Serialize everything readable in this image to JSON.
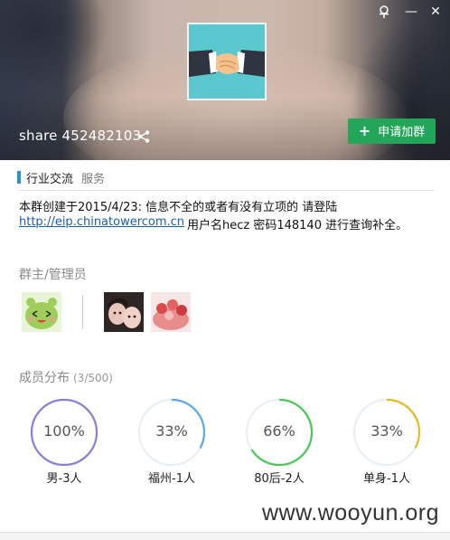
{
  "window": {
    "pin_icon": "pin-icon",
    "min_glyph": "—",
    "close_glyph": "✕"
  },
  "group": {
    "id_label": "share 452482103",
    "join_label": "申请加群",
    "join_plus": "+"
  },
  "tags": {
    "primary": "行业交流",
    "secondary": "服务"
  },
  "description": {
    "line1": "本群创建于2015/4/23:  信息不全的或者有没有立项的   请登陆",
    "link": "http://eip.chinatowercom.cn",
    "line2_rest": "用户名hecz  密码148140  进行查询补全。"
  },
  "admins": {
    "title": "群主/管理员"
  },
  "members": {
    "title": "成员分布",
    "count": "(3/500)",
    "stats": [
      {
        "percent_label": "100%",
        "label": "男-3人",
        "fraction": 1.0,
        "color": "#8b7fd6"
      },
      {
        "percent_label": "33%",
        "label": "福州-1人",
        "fraction": 0.33,
        "color": "#5aa9e6"
      },
      {
        "percent_label": "66%",
        "label": "80后-2人",
        "fraction": 0.66,
        "color": "#48c856"
      },
      {
        "percent_label": "33%",
        "label": "单身-1人",
        "fraction": 0.33,
        "color": "#e8b825"
      }
    ]
  },
  "watermark": "www.wooyun.org"
}
